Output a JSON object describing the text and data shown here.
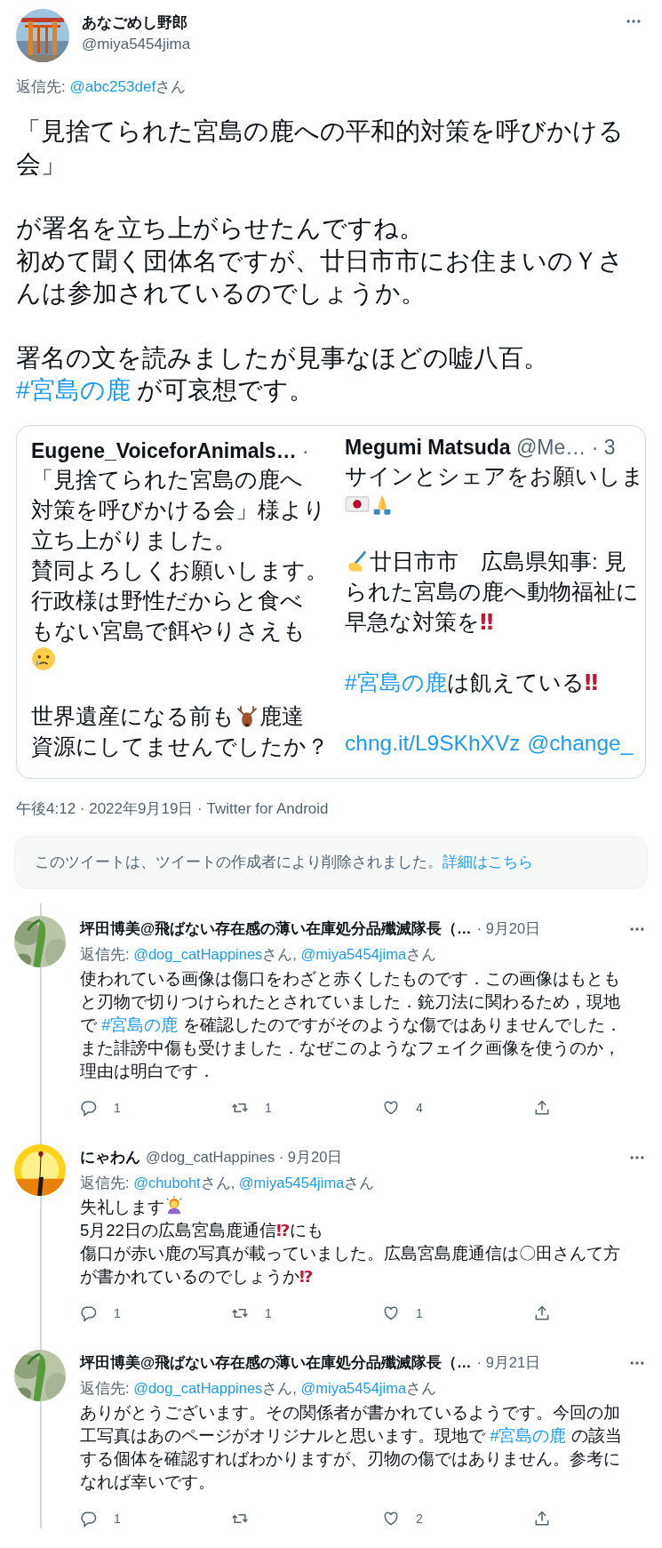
{
  "tweet": {
    "author": {
      "name": "あなごめし野郎",
      "handle": "@miya5454jima"
    },
    "reply_to": [
      {
        "kind": "text",
        "text": "返信先: "
      },
      {
        "kind": "mention",
        "text": "@abc253def"
      },
      {
        "kind": "text",
        "text": "さん"
      }
    ],
    "body": [
      [
        {
          "kind": "text",
          "text": "「見捨てられた宮島の鹿への平和的対策を呼びかける会」"
        }
      ],
      [
        {
          "kind": "text",
          "text": "が署名を立ち上がらせたんですね。"
        },
        {
          "kind": "break"
        },
        {
          "kind": "text",
          "text": "初めて聞く団体名ですが、廿日市市にお住まいのＹさんは参加されているのでしょうか。"
        }
      ],
      [
        {
          "kind": "text",
          "text": "署名の文を読みましたが見事なほどの嘘八百。"
        },
        {
          "kind": "break"
        },
        {
          "kind": "hashtag",
          "text": "#宮島の鹿"
        },
        {
          "kind": "text",
          "text": " が可哀想です。"
        }
      ]
    ],
    "embedded_screenshot": {
      "columns": [
        {
          "header": [
            {
              "kind": "name",
              "text": "Eugene_VoiceforAnimals…"
            },
            {
              "kind": "meta",
              "text": " ·"
            }
          ],
          "paragraphs": [
            [
              [
                {
                  "kind": "text",
                  "text": "「見捨てられた宮島の鹿へ"
                }
              ],
              [
                {
                  "kind": "text",
                  "text": "対策を呼びかける会」様より"
                }
              ],
              [
                {
                  "kind": "text",
                  "text": "立ち上がりました。"
                }
              ],
              [
                {
                  "kind": "text",
                  "text": "賛同よろしくお願いします。"
                }
              ],
              [
                {
                  "kind": "text",
                  "text": "行政様は野性だからと食べ"
                }
              ],
              [
                {
                  "kind": "text",
                  "text": "もない宮島で餌やりさえも"
                }
              ],
              [
                {
                  "kind": "crying"
                }
              ]
            ],
            [
              [
                {
                  "kind": "text",
                  "text": "世界遺産になる前も"
                },
                {
                  "kind": "deer"
                },
                {
                  "kind": "text",
                  "text": "鹿達"
                }
              ],
              [
                {
                  "kind": "text",
                  "text": "資源にしてませんでしたか？"
                }
              ]
            ]
          ]
        },
        {
          "header": [
            {
              "kind": "name",
              "text": "Megumi Matsuda"
            },
            {
              "kind": "meta",
              "text": " @Me… · 3"
            }
          ],
          "paragraphs": [
            [
              [
                {
                  "kind": "text",
                  "text": "サインとシェアをお願いしま"
                }
              ],
              [
                {
                  "kind": "flag"
                },
                {
                  "kind": "pray"
                }
              ]
            ],
            [
              [
                {
                  "kind": "writing"
                },
                {
                  "kind": "text",
                  "text": "廿日市市　広島県知事: 見"
                }
              ],
              [
                {
                  "kind": "text",
                  "text": "られた宮島の鹿へ動物福祉に"
                }
              ],
              [
                {
                  "kind": "text",
                  "text": "早急な対策を"
                },
                {
                  "kind": "mark",
                  "text": "‼"
                }
              ]
            ],
            [
              [
                {
                  "kind": "hashtag",
                  "text": "#宮島の鹿"
                },
                {
                  "kind": "text",
                  "text": " は飢えている"
                },
                {
                  "kind": "mark",
                  "text": "‼"
                }
              ]
            ],
            [
              [
                {
                  "kind": "link",
                  "text": "chng.it/L9SKhXVz"
                },
                {
                  "kind": "link",
                  "text": "@change_"
                }
              ]
            ]
          ]
        }
      ]
    },
    "timestamp": "午後4:12 · 2022年9月19日 · Twitter for Android"
  },
  "deleted_notice": {
    "text": "このツイートは、ツイートの作成者により削除されました。",
    "link": "詳細はこちら"
  },
  "replies": [
    {
      "name": "坪田博美@飛ばない存在感の薄い在庫処分品殲滅隊長（…",
      "meta": "· 9月20日",
      "reply_to": [
        {
          "kind": "text",
          "text": "返信先: "
        },
        {
          "kind": "mention",
          "text": "@dog_catHappines"
        },
        {
          "kind": "text",
          "text": "さん, "
        },
        {
          "kind": "mention",
          "text": "@miya5454jima"
        },
        {
          "kind": "text",
          "text": "さん"
        }
      ],
      "body": [
        {
          "kind": "text",
          "text": "使われている画像は傷口をわざと赤くしたものです．この画像はもともと刃物で切りつけられたとされていました．銃刀法に関わるため，現地で "
        },
        {
          "kind": "hashtag",
          "text": "#宮島の鹿"
        },
        {
          "kind": "text",
          "text": " を確認したのですがそのような傷ではありませんでした．また誹謗中傷も受けました．なぜこのようなフェイク画像を使うのか，理由は明白です．"
        }
      ],
      "actions": {
        "replies": "1",
        "retweets": "1",
        "likes": "4"
      }
    },
    {
      "name": "にゃわん",
      "meta": "@dog_catHappines · 9月20日",
      "reply_to": [
        {
          "kind": "text",
          "text": "返信先: "
        },
        {
          "kind": "mention",
          "text": "@chuboht"
        },
        {
          "kind": "text",
          "text": "さん, "
        },
        {
          "kind": "mention",
          "text": "@miya5454jima"
        },
        {
          "kind": "text",
          "text": "さん"
        }
      ],
      "body": [
        {
          "kind": "text",
          "text": "失礼します"
        },
        {
          "kind": "person"
        },
        {
          "kind": "break"
        },
        {
          "kind": "text",
          "text": "5月22日の広島宮島鹿通信"
        },
        {
          "kind": "mark",
          "text": "⁉"
        },
        {
          "kind": "text",
          "text": "にも"
        },
        {
          "kind": "break"
        },
        {
          "kind": "text",
          "text": "傷口が赤い鹿の写真が載っていました。広島宮島鹿通信は〇田さんて方が書かれているのでしょうか"
        },
        {
          "kind": "mark",
          "text": "⁉"
        }
      ],
      "actions": {
        "replies": "1",
        "retweets": "1",
        "likes": "1"
      }
    },
    {
      "name": "坪田博美@飛ばない存在感の薄い在庫処分品殲滅隊長（…",
      "meta": "· 9月21日",
      "reply_to": [
        {
          "kind": "text",
          "text": "返信先: "
        },
        {
          "kind": "mention",
          "text": "@dog_catHappines"
        },
        {
          "kind": "text",
          "text": "さん, "
        },
        {
          "kind": "mention",
          "text": "@miya5454jima"
        },
        {
          "kind": "text",
          "text": "さん"
        }
      ],
      "body": [
        {
          "kind": "text",
          "text": "ありがとうございます。その関係者が書かれているようです。今回の加工写真はあのページがオリジナルと思います。現地で "
        },
        {
          "kind": "hashtag",
          "text": "#宮島の鹿"
        },
        {
          "kind": "text",
          "text": " の該当する個体を確認すればわかりますが、刃物の傷ではありません。参考になれば幸いです。"
        }
      ],
      "actions": {
        "replies": "1",
        "likes": "2"
      }
    }
  ]
}
